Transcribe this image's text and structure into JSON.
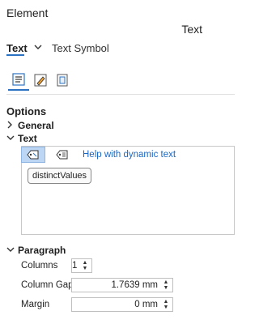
{
  "panel": {
    "title": "Element",
    "subtitle": "Text"
  },
  "tabs": {
    "text_label": "Text",
    "dropdown_icon": "chevron-down-icon",
    "symbol_label": "Text Symbol"
  },
  "toolbar_icons": [
    "text-properties-icon",
    "edit-pen-icon",
    "layout-frame-icon"
  ],
  "options": {
    "heading": "Options",
    "general_label": "General",
    "text_label": "Text",
    "help_link": "Help with dynamic text",
    "dynamic_tag": "distinctValues"
  },
  "paragraph": {
    "label": "Paragraph",
    "columns_label": "Columns",
    "columns_value": "1",
    "column_gap_label": "Column Gap",
    "column_gap_value": "1.7639 mm",
    "margin_label": "Margin",
    "margin_value": "0 mm"
  },
  "colors": {
    "accent": "#2b73c2",
    "link": "#1a67c2",
    "active_tag_bg": "#bcd6f3"
  }
}
